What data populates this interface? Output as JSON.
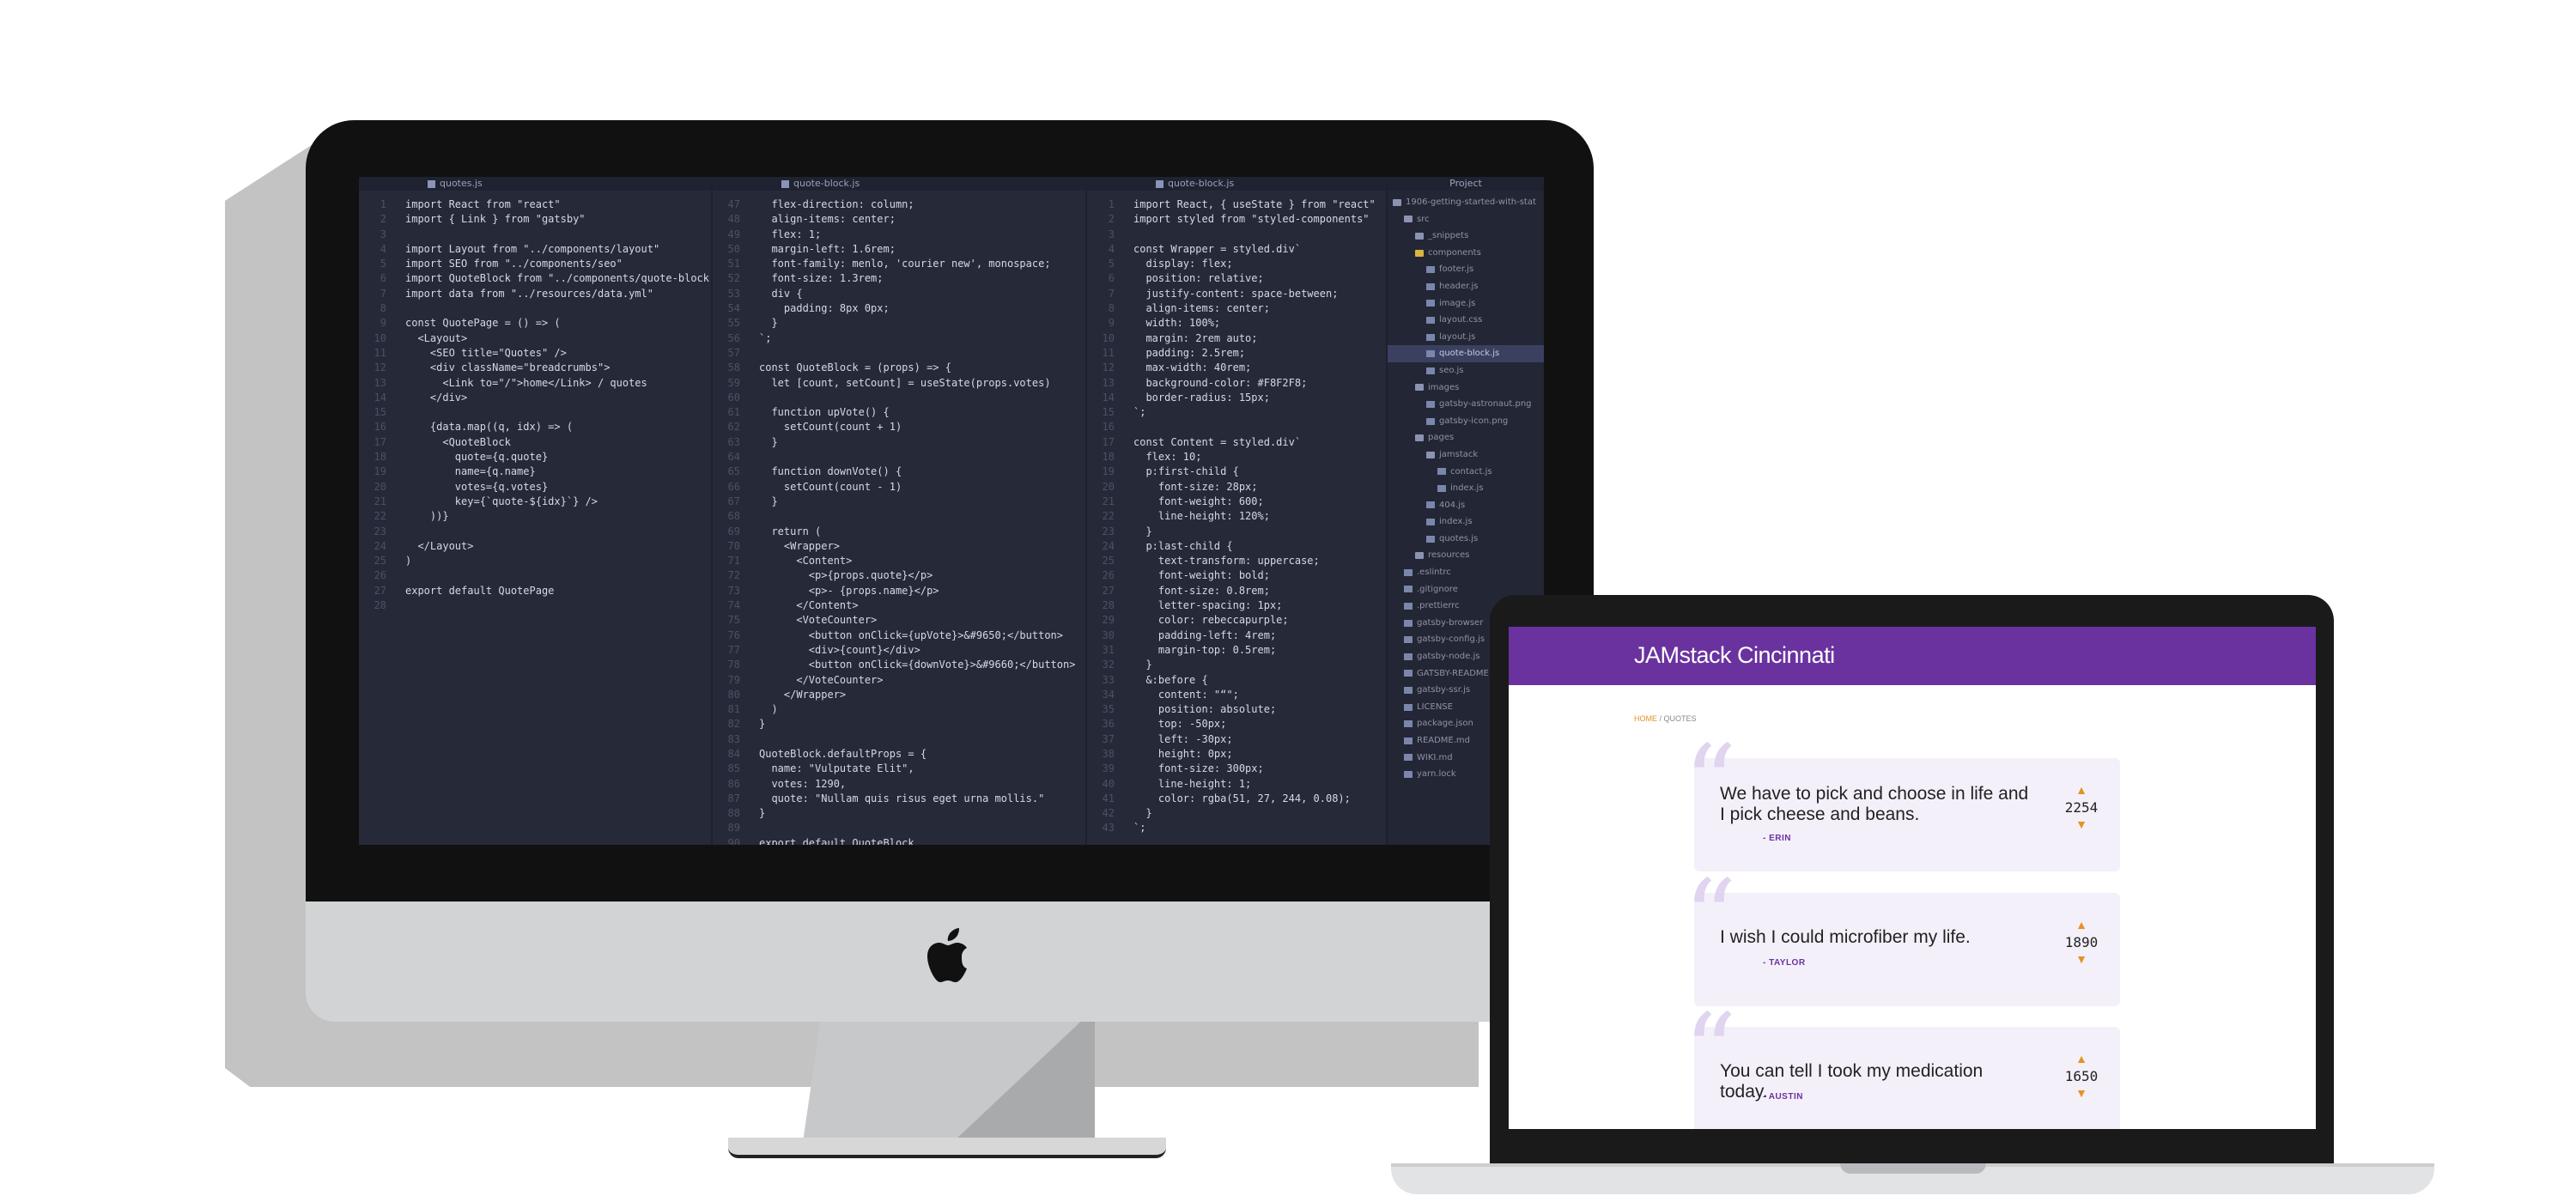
{
  "editor": {
    "tabs": [
      "quotes.js",
      "quote-block.js",
      "quote-block.js"
    ],
    "project_title": "Project",
    "pane1": [
      {
        "n": "1",
        "t": "import React from \"react\""
      },
      {
        "n": "2",
        "t": "import { Link } from \"gatsby\""
      },
      {
        "n": "3",
        "t": ""
      },
      {
        "n": "4",
        "t": "import Layout from \"../components/layout\""
      },
      {
        "n": "5",
        "t": "import SEO from \"../components/seo\""
      },
      {
        "n": "6",
        "t": "import QuoteBlock from \"../components/quote-block\""
      },
      {
        "n": "7",
        "t": "import data from \"../resources/data.yml\""
      },
      {
        "n": "8",
        "t": ""
      },
      {
        "n": "9",
        "t": "const QuotePage = () => ("
      },
      {
        "n": "10",
        "t": "  <Layout>"
      },
      {
        "n": "11",
        "t": "    <SEO title=\"Quotes\" />"
      },
      {
        "n": "12",
        "t": "    <div className=\"breadcrumbs\">"
      },
      {
        "n": "13",
        "t": "      <Link to=\"/\">home</Link> / quotes"
      },
      {
        "n": "14",
        "t": "    </div>"
      },
      {
        "n": "15",
        "t": ""
      },
      {
        "n": "16",
        "t": "    {data.map((q, idx) => ("
      },
      {
        "n": "17",
        "t": "      <QuoteBlock"
      },
      {
        "n": "18",
        "t": "        quote={q.quote}"
      },
      {
        "n": "19",
        "t": "        name={q.name}"
      },
      {
        "n": "20",
        "t": "        votes={q.votes}"
      },
      {
        "n": "21",
        "t": "        key={`quote-${idx}`} />"
      },
      {
        "n": "22",
        "t": "    ))}"
      },
      {
        "n": "23",
        "t": ""
      },
      {
        "n": "24",
        "t": "  </Layout>"
      },
      {
        "n": "25",
        "t": ")"
      },
      {
        "n": "26",
        "t": ""
      },
      {
        "n": "27",
        "t": "export default QuotePage"
      },
      {
        "n": "28",
        "t": ""
      }
    ],
    "pane2": [
      {
        "n": "47",
        "t": "  flex-direction: column;"
      },
      {
        "n": "48",
        "t": "  align-items: center;"
      },
      {
        "n": "49",
        "t": "  flex: 1;"
      },
      {
        "n": "50",
        "t": "  margin-left: 1.6rem;"
      },
      {
        "n": "51",
        "t": "  font-family: menlo, 'courier new', monospace;"
      },
      {
        "n": "52",
        "t": "  font-size: 1.3rem;"
      },
      {
        "n": "53",
        "t": "  div {"
      },
      {
        "n": "54",
        "t": "    padding: 8px 0px;"
      },
      {
        "n": "55",
        "t": "  }"
      },
      {
        "n": "56",
        "t": "`;"
      },
      {
        "n": "57",
        "t": ""
      },
      {
        "n": "58",
        "t": "const QuoteBlock = (props) => {"
      },
      {
        "n": "59",
        "t": "  let [count, setCount] = useState(props.votes)"
      },
      {
        "n": "60",
        "t": ""
      },
      {
        "n": "61",
        "t": "  function upVote() {"
      },
      {
        "n": "62",
        "t": "    setCount(count + 1)"
      },
      {
        "n": "63",
        "t": "  }"
      },
      {
        "n": "64",
        "t": ""
      },
      {
        "n": "65",
        "t": "  function downVote() {"
      },
      {
        "n": "66",
        "t": "    setCount(count - 1)"
      },
      {
        "n": "67",
        "t": "  }"
      },
      {
        "n": "68",
        "t": ""
      },
      {
        "n": "69",
        "t": "  return ("
      },
      {
        "n": "70",
        "t": "    <Wrapper>"
      },
      {
        "n": "71",
        "t": "      <Content>"
      },
      {
        "n": "72",
        "t": "        <p>{props.quote}</p>"
      },
      {
        "n": "73",
        "t": "        <p>- {props.name}</p>"
      },
      {
        "n": "74",
        "t": "      </Content>"
      },
      {
        "n": "75",
        "t": "      <VoteCounter>"
      },
      {
        "n": "76",
        "t": "        <button onClick={upVote}>&#9650;</button>"
      },
      {
        "n": "77",
        "t": "        <div>{count}</div>"
      },
      {
        "n": "78",
        "t": "        <button onClick={downVote}>&#9660;</button>"
      },
      {
        "n": "79",
        "t": "      </VoteCounter>"
      },
      {
        "n": "80",
        "t": "    </Wrapper>"
      },
      {
        "n": "81",
        "t": "  )"
      },
      {
        "n": "82",
        "t": "}"
      },
      {
        "n": "83",
        "t": ""
      },
      {
        "n": "84",
        "t": "QuoteBlock.defaultProps = {"
      },
      {
        "n": "85",
        "t": "  name: \"Vulputate Elit\","
      },
      {
        "n": "86",
        "t": "  votes: 1290,"
      },
      {
        "n": "87",
        "t": "  quote: \"Nullam quis risus eget urna mollis.\""
      },
      {
        "n": "88",
        "t": "}"
      },
      {
        "n": "89",
        "t": ""
      },
      {
        "n": "90",
        "t": "export default QuoteBlock"
      }
    ],
    "pane3": [
      {
        "n": "1",
        "t": "import React, { useState } from \"react\""
      },
      {
        "n": "2",
        "t": "import styled from \"styled-components\""
      },
      {
        "n": "3",
        "t": ""
      },
      {
        "n": "4",
        "t": "const Wrapper = styled.div`"
      },
      {
        "n": "5",
        "t": "  display: flex;"
      },
      {
        "n": "6",
        "t": "  position: relative;"
      },
      {
        "n": "7",
        "t": "  justify-content: space-between;"
      },
      {
        "n": "8",
        "t": "  align-items: center;"
      },
      {
        "n": "9",
        "t": "  width: 100%;"
      },
      {
        "n": "10",
        "t": "  margin: 2rem auto;"
      },
      {
        "n": "11",
        "t": "  padding: 2.5rem;"
      },
      {
        "n": "12",
        "t": "  max-width: 40rem;"
      },
      {
        "n": "13",
        "t": "  background-color: #F8F2F8;"
      },
      {
        "n": "14",
        "t": "  border-radius: 15px;"
      },
      {
        "n": "15",
        "t": "`;"
      },
      {
        "n": "16",
        "t": ""
      },
      {
        "n": "17",
        "t": "const Content = styled.div`"
      },
      {
        "n": "18",
        "t": "  flex: 10;"
      },
      {
        "n": "19",
        "t": "  p:first-child {"
      },
      {
        "n": "20",
        "t": "    font-size: 28px;"
      },
      {
        "n": "21",
        "t": "    font-weight: 600;"
      },
      {
        "n": "22",
        "t": "    line-height: 120%;"
      },
      {
        "n": "23",
        "t": "  }"
      },
      {
        "n": "24",
        "t": "  p:last-child {"
      },
      {
        "n": "25",
        "t": "    text-transform: uppercase;"
      },
      {
        "n": "26",
        "t": "    font-weight: bold;"
      },
      {
        "n": "27",
        "t": "    font-size: 0.8rem;"
      },
      {
        "n": "28",
        "t": "    letter-spacing: 1px;"
      },
      {
        "n": "29",
        "t": "    color: rebeccapurple;"
      },
      {
        "n": "30",
        "t": "    padding-left: 4rem;"
      },
      {
        "n": "31",
        "t": "    margin-top: 0.5rem;"
      },
      {
        "n": "32",
        "t": "  }"
      },
      {
        "n": "33",
        "t": "  &:before {"
      },
      {
        "n": "34",
        "t": "    content: \"“\";"
      },
      {
        "n": "35",
        "t": "    position: absolute;"
      },
      {
        "n": "36",
        "t": "    top: -50px;"
      },
      {
        "n": "37",
        "t": "    left: -30px;"
      },
      {
        "n": "38",
        "t": "    height: 0px;"
      },
      {
        "n": "39",
        "t": "    font-size: 300px;"
      },
      {
        "n": "40",
        "t": "    line-height: 1;"
      },
      {
        "n": "41",
        "t": "    color: rgba(51, 27, 244, 0.08);"
      },
      {
        "n": "42",
        "t": "  }"
      },
      {
        "n": "43",
        "t": "`;"
      }
    ],
    "tree": [
      {
        "label": "1906-getting-started-with-stat",
        "indent": 0,
        "kind": "folder"
      },
      {
        "label": "src",
        "indent": 1,
        "kind": "folder"
      },
      {
        "label": "_snippets",
        "indent": 2,
        "kind": "folder"
      },
      {
        "label": "components",
        "indent": 2,
        "kind": "open"
      },
      {
        "label": "footer.js",
        "indent": 3,
        "kind": "file"
      },
      {
        "label": "header.js",
        "indent": 3,
        "kind": "file"
      },
      {
        "label": "image.js",
        "indent": 3,
        "kind": "file"
      },
      {
        "label": "layout.css",
        "indent": 3,
        "kind": "file"
      },
      {
        "label": "layout.js",
        "indent": 3,
        "kind": "file"
      },
      {
        "label": "quote-block.js",
        "indent": 3,
        "kind": "file",
        "selected": true
      },
      {
        "label": "seo.js",
        "indent": 3,
        "kind": "file"
      },
      {
        "label": "images",
        "indent": 2,
        "kind": "folder"
      },
      {
        "label": "gatsby-astronaut.png",
        "indent": 3,
        "kind": "file"
      },
      {
        "label": "gatsby-icon.png",
        "indent": 3,
        "kind": "file"
      },
      {
        "label": "pages",
        "indent": 2,
        "kind": "folder"
      },
      {
        "label": "jamstack",
        "indent": 3,
        "kind": "folder"
      },
      {
        "label": "contact.js",
        "indent": 4,
        "kind": "file"
      },
      {
        "label": "index.js",
        "indent": 4,
        "kind": "file"
      },
      {
        "label": "404.js",
        "indent": 3,
        "kind": "file"
      },
      {
        "label": "index.js",
        "indent": 3,
        "kind": "file"
      },
      {
        "label": "quotes.js",
        "indent": 3,
        "kind": "file"
      },
      {
        "label": "resources",
        "indent": 2,
        "kind": "folder"
      },
      {
        "label": ".eslintrc",
        "indent": 1,
        "kind": "file"
      },
      {
        "label": ".gitignore",
        "indent": 1,
        "kind": "file"
      },
      {
        "label": ".prettierrc",
        "indent": 1,
        "kind": "file"
      },
      {
        "label": "gatsby-browser",
        "indent": 1,
        "kind": "file"
      },
      {
        "label": "gatsby-config.js",
        "indent": 1,
        "kind": "file"
      },
      {
        "label": "gatsby-node.js",
        "indent": 1,
        "kind": "file"
      },
      {
        "label": "GATSBY-README",
        "indent": 1,
        "kind": "file"
      },
      {
        "label": "gatsby-ssr.js",
        "indent": 1,
        "kind": "file"
      },
      {
        "label": "LICENSE",
        "indent": 1,
        "kind": "file"
      },
      {
        "label": "package.json",
        "indent": 1,
        "kind": "file"
      },
      {
        "label": "README.md",
        "indent": 1,
        "kind": "file"
      },
      {
        "label": "WIKI.md",
        "indent": 1,
        "kind": "file"
      },
      {
        "label": "yarn.lock",
        "indent": 1,
        "kind": "file"
      }
    ]
  },
  "site": {
    "title": "JAMstack Cincinnati",
    "breadcrumb_home": "HOME",
    "breadcrumb_sep": " / ",
    "breadcrumb_current": "QUOTES",
    "quotes": [
      {
        "quote": "We have to pick and choose in life and I pick cheese and beans.",
        "name": "- ERIN",
        "votes": "2254"
      },
      {
        "quote": "I wish I could microfiber my life.",
        "name": "- TAYLOR",
        "votes": "1890"
      },
      {
        "quote": "You can tell I took my medication today.",
        "name": "- AUSTIN",
        "votes": "1650"
      }
    ],
    "up_arrow": "▲",
    "down_arrow": "▼",
    "quote_mark": "“"
  },
  "colors": {
    "brand_purple": "#6a329f",
    "accent_orange": "#e59226",
    "editor_bg": "#262a38"
  }
}
